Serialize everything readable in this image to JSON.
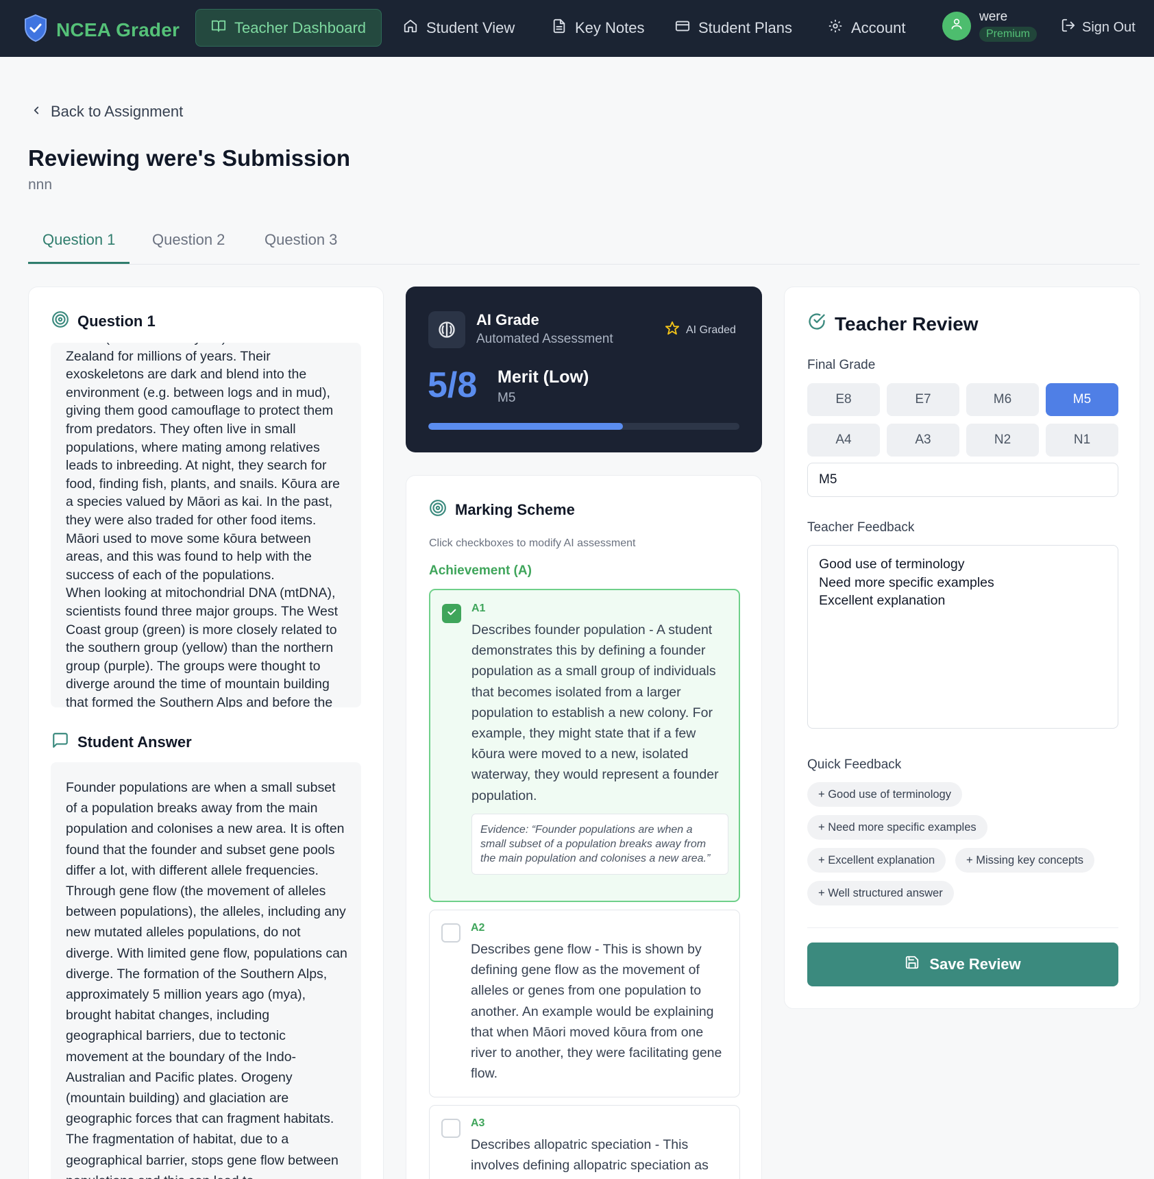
{
  "nav": {
    "brand": "NCEA Grader",
    "items": [
      {
        "label": "Teacher Dashboard",
        "icon": "book-open-icon",
        "active": true
      },
      {
        "label": "Student View",
        "icon": "home-icon",
        "active": false
      },
      {
        "label": "Key Notes",
        "icon": "file-text-icon",
        "active": false
      },
      {
        "label": "Student Plans",
        "icon": "credit-card-icon",
        "active": false
      },
      {
        "label": "Account",
        "icon": "gear-icon",
        "active": false
      }
    ],
    "user": {
      "name": "were",
      "plan": "Premium"
    },
    "sign_out": "Sign Out"
  },
  "page": {
    "back_label": "Back to Assignment",
    "title": "Reviewing were's Submission",
    "subtitle": "nnn",
    "tabs": [
      {
        "label": "Question 1",
        "active": true
      },
      {
        "label": "Question 2",
        "active": false
      },
      {
        "label": "Question 3",
        "active": false
      }
    ]
  },
  "question": {
    "heading": "Question 1",
    "text": "Kōura (freshwater crayfish) have inhabited New Zealand for millions of years. Their exoskeletons are dark and blend into the environment (e.g. between logs and in mud), giving them good camouflage to protect them from predators. They often live in small populations, where mating among relatives leads to inbreeding. At night, they search for food, finding fish, plants, and snails. Kōura are a species valued by Māori as kai. In the past, they were also traded for other food items. Māori used to move some kōura between areas, and this was found to help with the success of each of the populations.\nWhen looking at mitochondrial DNA (mtDNA), scientists found three major groups. The West Coast group (green) is more closely related to the southern group (yellow) than the northern group (purple). The groups were thought to diverge around the time of mountain building that formed the Southern Alps and before the"
  },
  "student_answer": {
    "heading": "Student Answer",
    "text": "Founder populations are when a small subset of a population breaks away from the main population and colonises a new area. It is often found that the founder and subset gene pools differ a lot, with different allele frequencies. Through gene flow (the movement of alleles between populations), the alleles, including any new mutated alleles populations, do not diverge. With limited gene flow, populations can diverge. The formation of the Southern Alps, approximately 5 million years ago (mya), brought habitat changes, including geographical barriers, due to tectonic movement at the boundary of the Indo-Australian and Pacific plates. Orogeny (mountain building) and glaciation are geographic forces that can fragment habitats. The fragmentation of habitat, due to a geographical barrier, stops gene flow between populations and this can lead to"
  },
  "ai_grade": {
    "title": "AI Grade",
    "subtitle": "Automated Assessment",
    "tag": "AI Graded",
    "score": "5/8",
    "level": "Merit (Low)",
    "code": "M5",
    "progress": 0.625
  },
  "marking_scheme": {
    "heading": "Marking Scheme",
    "note": "Click checkboxes to modify AI assessment",
    "category": "Achievement (A)",
    "criteria": [
      {
        "code": "A1",
        "checked": true,
        "text": "Describes founder population - A student demonstrates this by defining a founder population as a small group of individuals that becomes isolated from a larger population to establish a new colony. For example, they might state that if a few kōura were moved to a new, isolated waterway, they would represent a founder population.",
        "evidence": "Evidence: “Founder populations are when a small subset of a population breaks away from the main population and colonises a new area.”"
      },
      {
        "code": "A2",
        "checked": false,
        "text": "Describes gene flow - This is shown by defining gene flow as the movement of alleles or genes from one population to another. An example would be explaining that when Māori moved kōura from one river to another, they were facilitating gene flow."
      },
      {
        "code": "A3",
        "checked": false,
        "text": "Describes allopatric speciation - This involves defining allopatric speciation as"
      }
    ]
  },
  "teacher_review": {
    "heading": "Teacher Review",
    "final_grade_label": "Final Grade",
    "grades": [
      "E8",
      "E7",
      "M6",
      "M5",
      "A4",
      "A3",
      "N2",
      "N1"
    ],
    "selected_grade": "M5",
    "grade_value": "M5",
    "feedback_label": "Teacher Feedback",
    "feedback_lines": [
      "Good use of terminology",
      "Need more specific examples",
      "Excellent explanation"
    ],
    "quick_label": "Quick Feedback",
    "quick_chips": [
      "+ Good use of terminology",
      "+ Need more specific examples",
      "+ Excellent explanation",
      "+ Missing key concepts",
      "+ Well structured answer"
    ],
    "save_label": "Save Review"
  },
  "colors": {
    "nav_bg": "#1b2433",
    "brand": "#55c178",
    "accent_teal": "#3b8a7e",
    "accent_blue": "#4f7fe6",
    "success": "#3fa55b"
  }
}
